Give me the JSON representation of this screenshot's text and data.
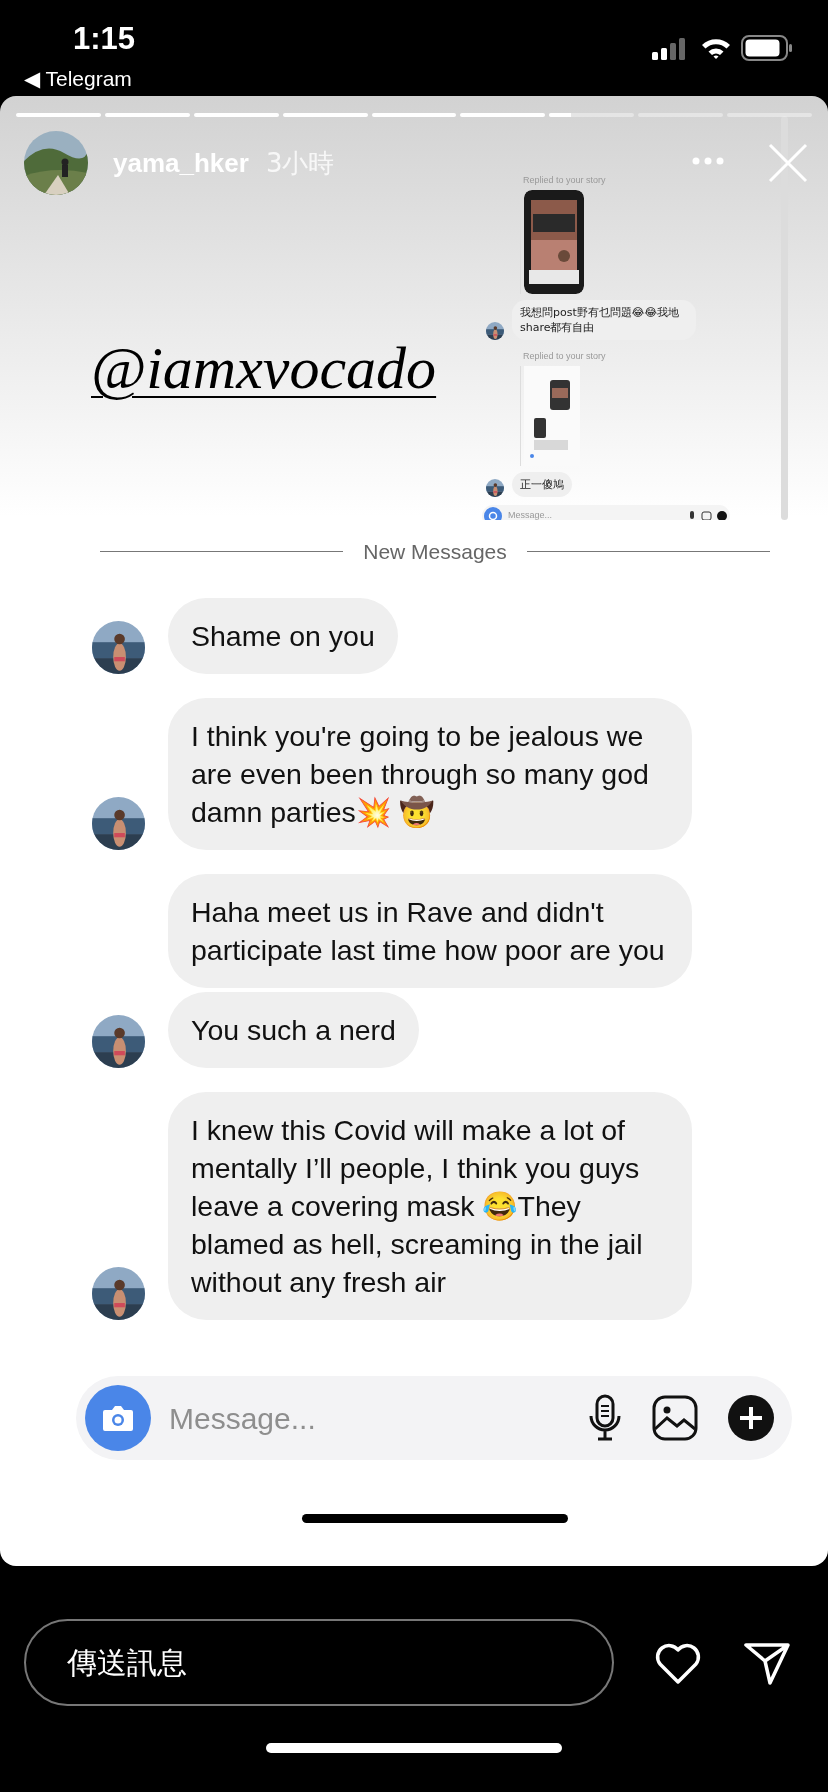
{
  "status_bar": {
    "time": "1:15",
    "back_app": "◀ Telegram"
  },
  "story": {
    "progress": [
      {
        "level": 1
      },
      {
        "level": 1
      },
      {
        "level": 1
      },
      {
        "level": 1
      },
      {
        "level": 1
      },
      {
        "level": 1
      },
      {
        "level": 0.25
      },
      {
        "level": 0
      },
      {
        "level": 0
      }
    ],
    "user": {
      "username": "yama_hker",
      "time": "3小時"
    },
    "sticker_text": "@iamxvocado",
    "embedded_screenshot": {
      "items": [
        {
          "kind": "reply_label",
          "text": "Replied to your story"
        },
        {
          "kind": "thumbnail"
        },
        {
          "kind": "message",
          "text": "我想問post野有乜問題😂😂我地share都有自由"
        },
        {
          "kind": "reply_label",
          "text": "Replied to your story"
        },
        {
          "kind": "thumbnail"
        },
        {
          "kind": "message",
          "text": "正一傻鳩"
        }
      ],
      "input_placeholder": "Message..."
    },
    "divider": "New Messages",
    "messages": [
      {
        "text": "Shame on you",
        "avatar": true
      },
      {
        "text": "I think you're going to be jealous we are even been through so many god damn parties💥 🤠",
        "avatar": true
      },
      {
        "text": "Haha meet us in Rave and didn't participate last time how poor are you",
        "avatar": false
      },
      {
        "text": "You such a nerd",
        "avatar": true
      },
      {
        "text": "I knew this Covid will make a lot of mentally I’ll people, I think you guys leave a covering mask 😂They blamed as hell, screaming in the jail without any fresh air",
        "avatar": true
      }
    ],
    "composer": {
      "placeholder": "Message..."
    }
  },
  "reply_bar": {
    "placeholder": "傳送訊息"
  }
}
